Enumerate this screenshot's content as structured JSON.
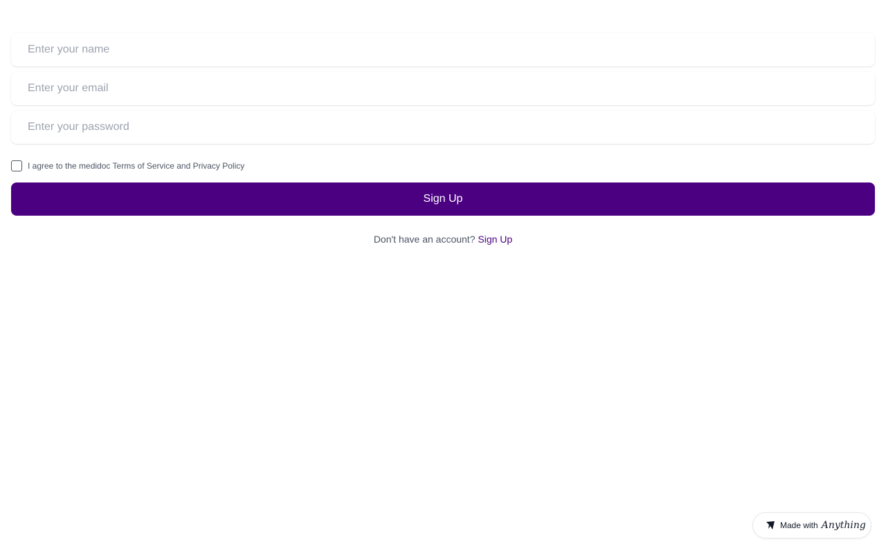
{
  "form": {
    "name_placeholder": "Enter your name",
    "email_placeholder": "Enter your email",
    "password_placeholder": "Enter your password",
    "agree_text": "I agree to the medidoc Terms of Service and Privacy Policy",
    "agree_checked": false,
    "submit_label": "Sign Up",
    "account_prompt": "Don't have an account?",
    "account_link": "Sign Up"
  },
  "badge": {
    "prefix": "Made with",
    "brand": "Anything",
    "icon": "anything-logo-icon"
  },
  "colors": {
    "primary": "#4b0082",
    "text": "#4b5563",
    "placeholder": "#9ca3af"
  }
}
